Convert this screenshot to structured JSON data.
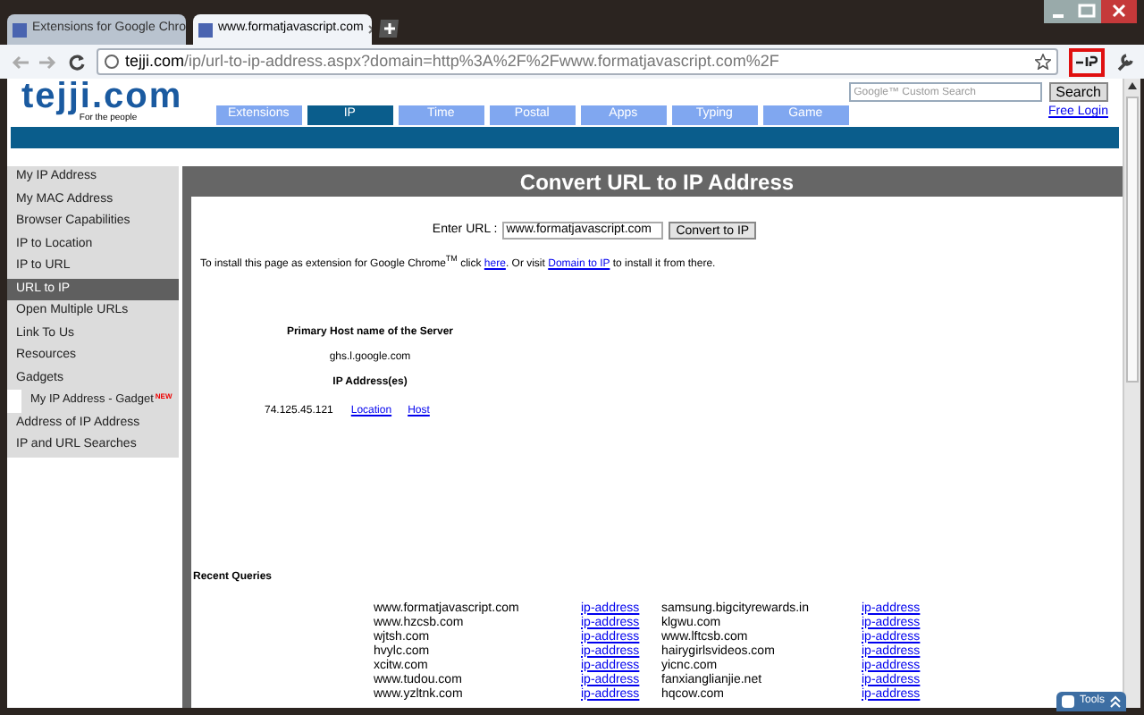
{
  "browser": {
    "tabs": [
      {
        "title": "Extensions for Google Chro",
        "selected": false
      },
      {
        "title": "www.formatjavascript.com",
        "selected": true
      }
    ],
    "address": {
      "host": "tejji.com",
      "path": "/ip/url-to-ip-address.aspx?domain=http%3A%2F%2Fwww.formatjavascript.com%2F"
    }
  },
  "site": {
    "logo": "tejji.com",
    "tagline": "For the people",
    "nav": [
      {
        "label": "Extensions",
        "selected": false
      },
      {
        "label": "IP",
        "selected": true
      },
      {
        "label": "Time",
        "selected": false
      },
      {
        "label": "Postal",
        "selected": false
      },
      {
        "label": "Apps",
        "selected": false
      },
      {
        "label": "Typing",
        "selected": false
      },
      {
        "label": "Game",
        "selected": false
      }
    ],
    "search": {
      "placeholder": "Google™ Custom Search",
      "button": "Search"
    },
    "login": "Free Login"
  },
  "sidebar": {
    "items": [
      {
        "label": "My IP Address",
        "selected": false,
        "kind": "item"
      },
      {
        "label": "My MAC Address",
        "selected": false,
        "kind": "item"
      },
      {
        "label": "Browser Capabilities",
        "selected": false,
        "kind": "item"
      },
      {
        "label": "IP to Location",
        "selected": false,
        "kind": "item"
      },
      {
        "label": "IP to URL",
        "selected": false,
        "kind": "item"
      },
      {
        "label": "URL to IP",
        "selected": true,
        "kind": "item"
      },
      {
        "label": "Open Multiple URLs",
        "selected": false,
        "kind": "item"
      },
      {
        "label": "Link To Us",
        "selected": false,
        "kind": "item"
      },
      {
        "label": "Resources",
        "selected": false,
        "kind": "item"
      },
      {
        "label": "Gadgets",
        "selected": false,
        "kind": "item"
      },
      {
        "label": "My IP Address - Gadget",
        "badge": "NEW",
        "selected": false,
        "kind": "sub"
      },
      {
        "label": "Address of IP Address",
        "selected": false,
        "kind": "item"
      },
      {
        "label": "IP and URL Searches",
        "selected": false,
        "kind": "item"
      }
    ]
  },
  "content": {
    "title": "Convert URL to IP Address",
    "url_label": "Enter URL :",
    "url_value": "www.formatjavascript.com",
    "convert_button": "Convert to IP",
    "install_note": [
      "To install this page as extension for Google Chrome$^{TM}$ click ",
      {
        "link": "here"
      },
      ". Or visit ",
      {
        "link": "Domain to IP"
      },
      " to install it from there."
    ],
    "host_heading": "Primary Host name of the Server",
    "host_value": "ghs.l.google.com",
    "ip_heading": "IP Address(es)",
    "ip_row": {
      "ip": "74.125.45.121",
      "links": [
        "Location",
        "Host"
      ]
    },
    "recent_title": "Recent Queries",
    "recent_rows": [
      [
        "www.formatjavascript.com",
        "ip-address",
        "samsung.bigcityrewards.in",
        "ip-address"
      ],
      [
        "www.hzcsb.com",
        "ip-address",
        "klgwu.com",
        "ip-address"
      ],
      [
        "wjtsh.com",
        "ip-address",
        "www.lftcsb.com",
        "ip-address"
      ],
      [
        "hvylc.com",
        "ip-address",
        "hairygirlsvideos.com",
        "ip-address"
      ],
      [
        "xcitw.com",
        "ip-address",
        "yicnc.com",
        "ip-address"
      ],
      [
        "www.tudou.com",
        "ip-address",
        "fanxianglianjie.net",
        "ip-address"
      ],
      [
        "www.yzltnk.com",
        "ip-address",
        "hqcow.com",
        "ip-address"
      ]
    ]
  },
  "tools": {
    "label": "Tools"
  }
}
